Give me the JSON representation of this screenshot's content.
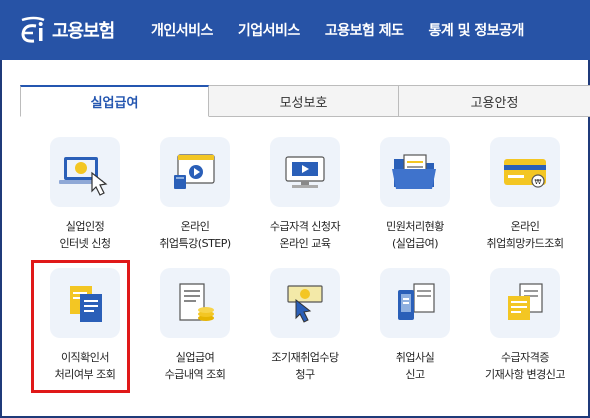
{
  "app": {
    "logo_text": "고용보험",
    "logo_icon": "ei-logo-icon"
  },
  "nav": {
    "items": [
      "개인서비스",
      "기업서비스",
      "고용보험 제도",
      "통계 및 정보공개"
    ]
  },
  "tabs": [
    {
      "label": "실업급여",
      "active": true
    },
    {
      "label": "모성보호",
      "active": false
    },
    {
      "label": "고용안정",
      "active": false
    }
  ],
  "services": [
    {
      "line1": "실업인정",
      "line2": "인터넷 신청",
      "icon": "laptop-touch-icon"
    },
    {
      "line1": "온라인",
      "line2": "취업특강(STEP)",
      "icon": "video-lecture-icon"
    },
    {
      "line1": "수급자격 신청자",
      "line2": "온라인 교육",
      "icon": "online-education-icon"
    },
    {
      "line1": "민원처리현황",
      "line2": "(실업급여)",
      "icon": "folder-document-icon"
    },
    {
      "line1": "온라인",
      "line2": "취업희망카드조회",
      "icon": "card-icon"
    },
    {
      "line1": "이직확인서",
      "line2": "처리여부 조회",
      "icon": "documents-icon"
    },
    {
      "line1": "실업급여",
      "line2": "수급내역 조회",
      "icon": "receipt-coins-icon"
    },
    {
      "line1": "조기재취업수당",
      "line2": "청구",
      "icon": "hand-cash-icon"
    },
    {
      "line1": "취업사실",
      "line2": "신고",
      "icon": "phone-document-icon"
    },
    {
      "line1": "수급자격증",
      "line2": "기재사항 변경신고",
      "icon": "certificate-edit-icon"
    }
  ],
  "colors": {
    "header_bg": "#2753a6",
    "accent": "#2456b0",
    "highlight": "#e01818",
    "tile_bg": "#eef3fa"
  }
}
